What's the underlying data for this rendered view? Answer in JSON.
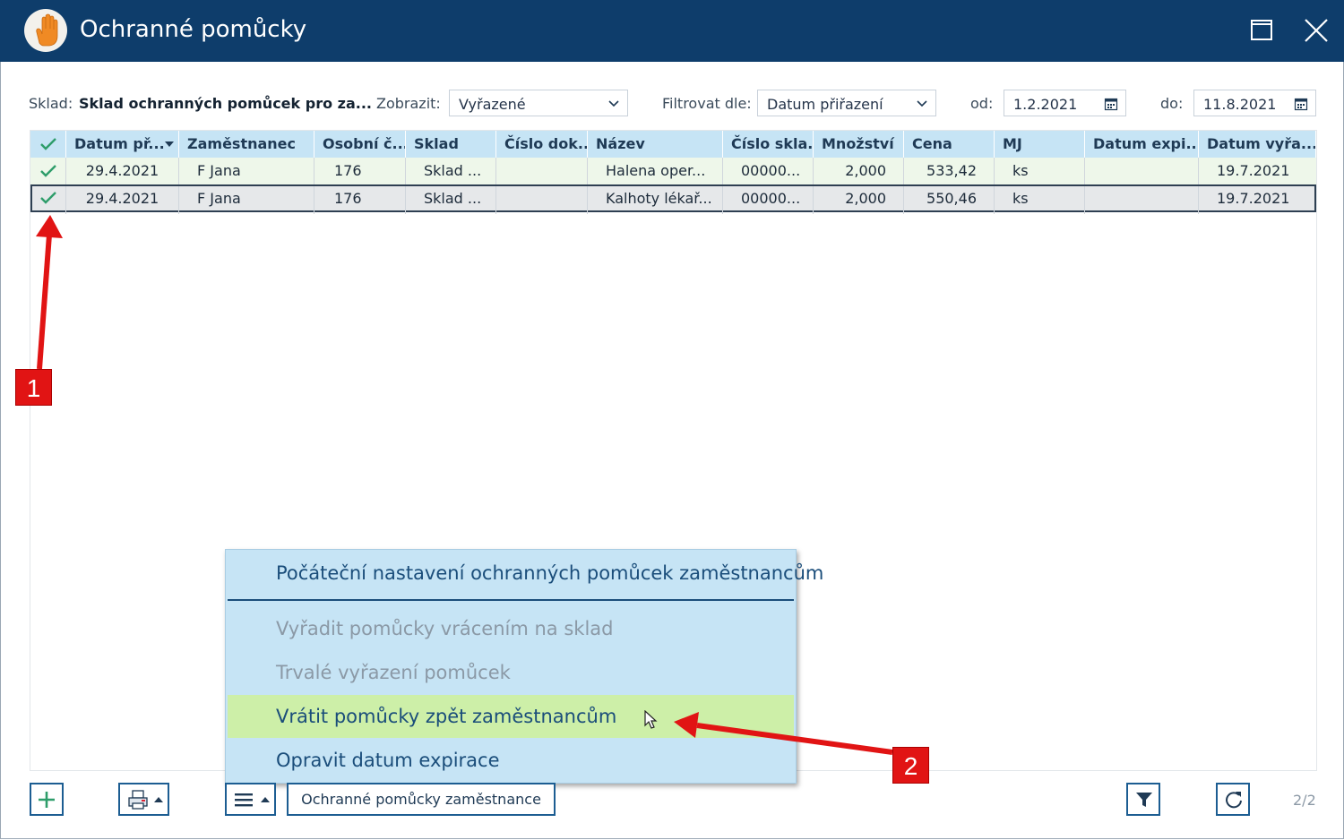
{
  "window": {
    "title": "Ochranné pomůcky"
  },
  "filters": {
    "sklad_label": "Sklad:",
    "sklad_value": "Sklad ochranných pomůcek pro za...",
    "zobrazit_label": "Zobrazit:",
    "zobrazit_value": "Vyřazené",
    "filtrovat_label": "Filtrovat dle:",
    "filtrovat_value": "Datum přiřazení",
    "od_label": "od:",
    "od_value": "1.2.2021",
    "do_label": "do:",
    "do_value": "11.8.2021"
  },
  "table": {
    "columns": [
      "Datum př...",
      "Zaměstnanec",
      "Osobní č...",
      "Sklad",
      "Číslo dok...",
      "Název",
      "Číslo skla...",
      "Množství",
      "Cena",
      "MJ",
      "Datum expi...",
      "Datum vyřa..."
    ],
    "rows": [
      [
        "29.4.2021",
        "F Jana",
        "176",
        "Sklad ...",
        "",
        "Halena oper...",
        "00000...",
        "2,000",
        "533,42",
        "ks",
        "",
        "19.7.2021"
      ],
      [
        "29.4.2021",
        "F Jana",
        "176",
        "Sklad ...",
        "",
        "Kalhoty lékař...",
        "00000...",
        "2,000",
        "550,46",
        "ks",
        "",
        "19.7.2021"
      ]
    ]
  },
  "menu": {
    "items": [
      "Počáteční nastavení ochranných pomůcek zaměstnancům",
      "Vyřadit pomůcky vrácením na sklad",
      "Trvalé vyřazení pomůcek",
      "Vrátit pomůcky zpět zaměstnancům",
      "Opravit datum expirace"
    ]
  },
  "toolbar": {
    "text_button": "Ochranné pomůcky zaměstnance",
    "pager": "2/2"
  },
  "annotations": {
    "badge1": "1",
    "badge2": "2"
  },
  "colors": {
    "titlebar": "#0e3d6b",
    "header": "#c6e4f5",
    "highlight": "#cdefa8",
    "check": "#2e9d6a",
    "annotation": "#e11414"
  },
  "icons": [
    "hand-icon",
    "maximize-icon",
    "close-icon",
    "check-icon",
    "sort-down-icon",
    "chevron-down-icon",
    "calendar-icon",
    "plus-icon",
    "print-icon",
    "menu-icon",
    "filter-icon",
    "refresh-icon",
    "cursor-icon"
  ]
}
